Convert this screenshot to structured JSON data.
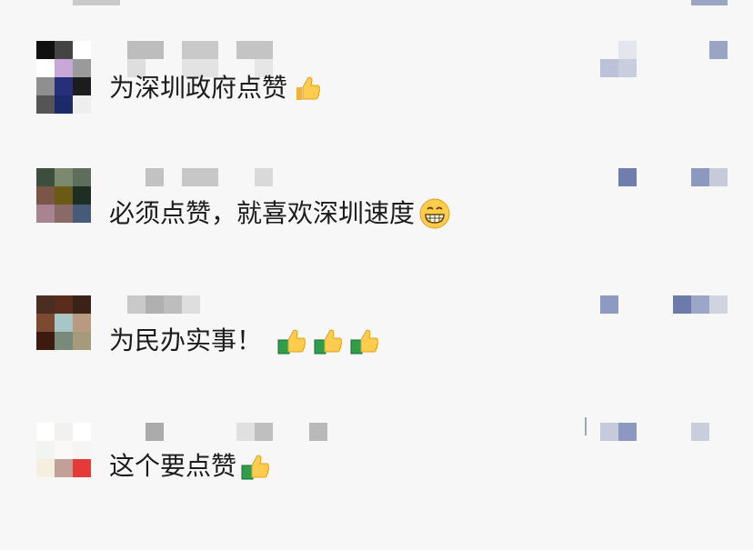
{
  "comments": [
    {
      "text": "为深圳政府点赞",
      "emojis": [
        "thumbs-up"
      ]
    },
    {
      "text": "必须点赞，就喜欢深圳速度",
      "emojis": [
        "grin"
      ]
    },
    {
      "text": "为民办实事！",
      "emojis": [
        "thumbs-up-money",
        "thumbs-up-money",
        "thumbs-up-money"
      ]
    },
    {
      "text": "这个要点赞",
      "emojis": [
        "thumbs-up-money"
      ]
    }
  ],
  "colors": {
    "background": "#f7f7f7",
    "text": "#1c1c1c",
    "mosaic_name": "#b7b7b7",
    "mosaic_like": "#7f8db3"
  }
}
